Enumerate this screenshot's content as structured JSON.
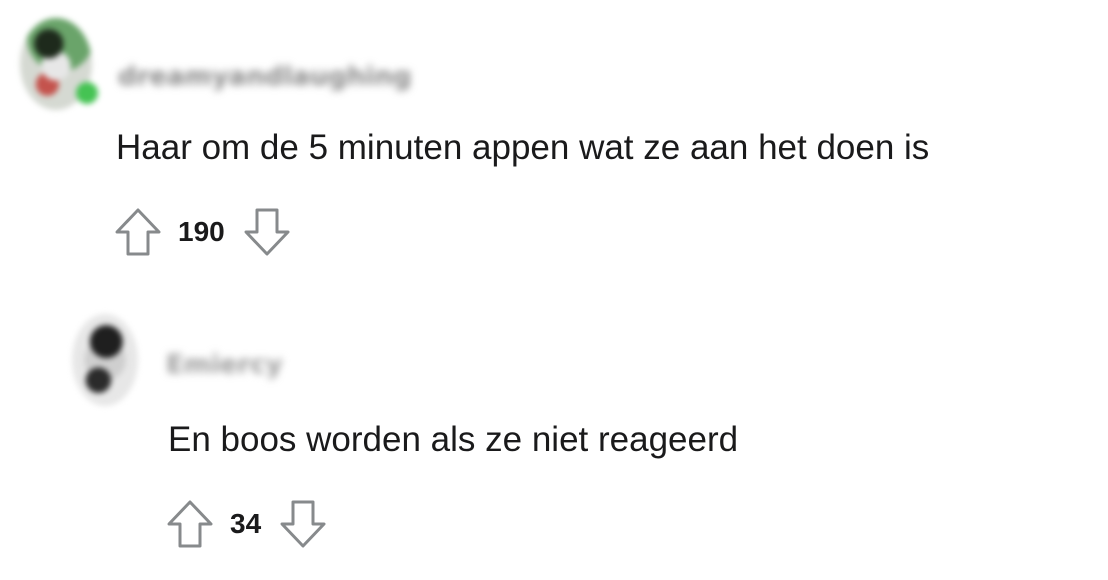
{
  "comments": [
    {
      "username": "dreamyandlaughing",
      "text": "Haar om de 5 minuten appen wat ze aan het doen is",
      "score": "190",
      "upvote_icon": "upvote-arrow-icon",
      "downvote_icon": "downvote-arrow-icon"
    },
    {
      "username": "Emiercy",
      "text": "En boos worden als ze niet reageerd",
      "score": "34",
      "upvote_icon": "upvote-arrow-icon",
      "downvote_icon": "downvote-arrow-icon"
    }
  ],
  "colors": {
    "text": "#1a1a1b",
    "icon_stroke": "#878a8c",
    "online_status": "#45c353"
  }
}
